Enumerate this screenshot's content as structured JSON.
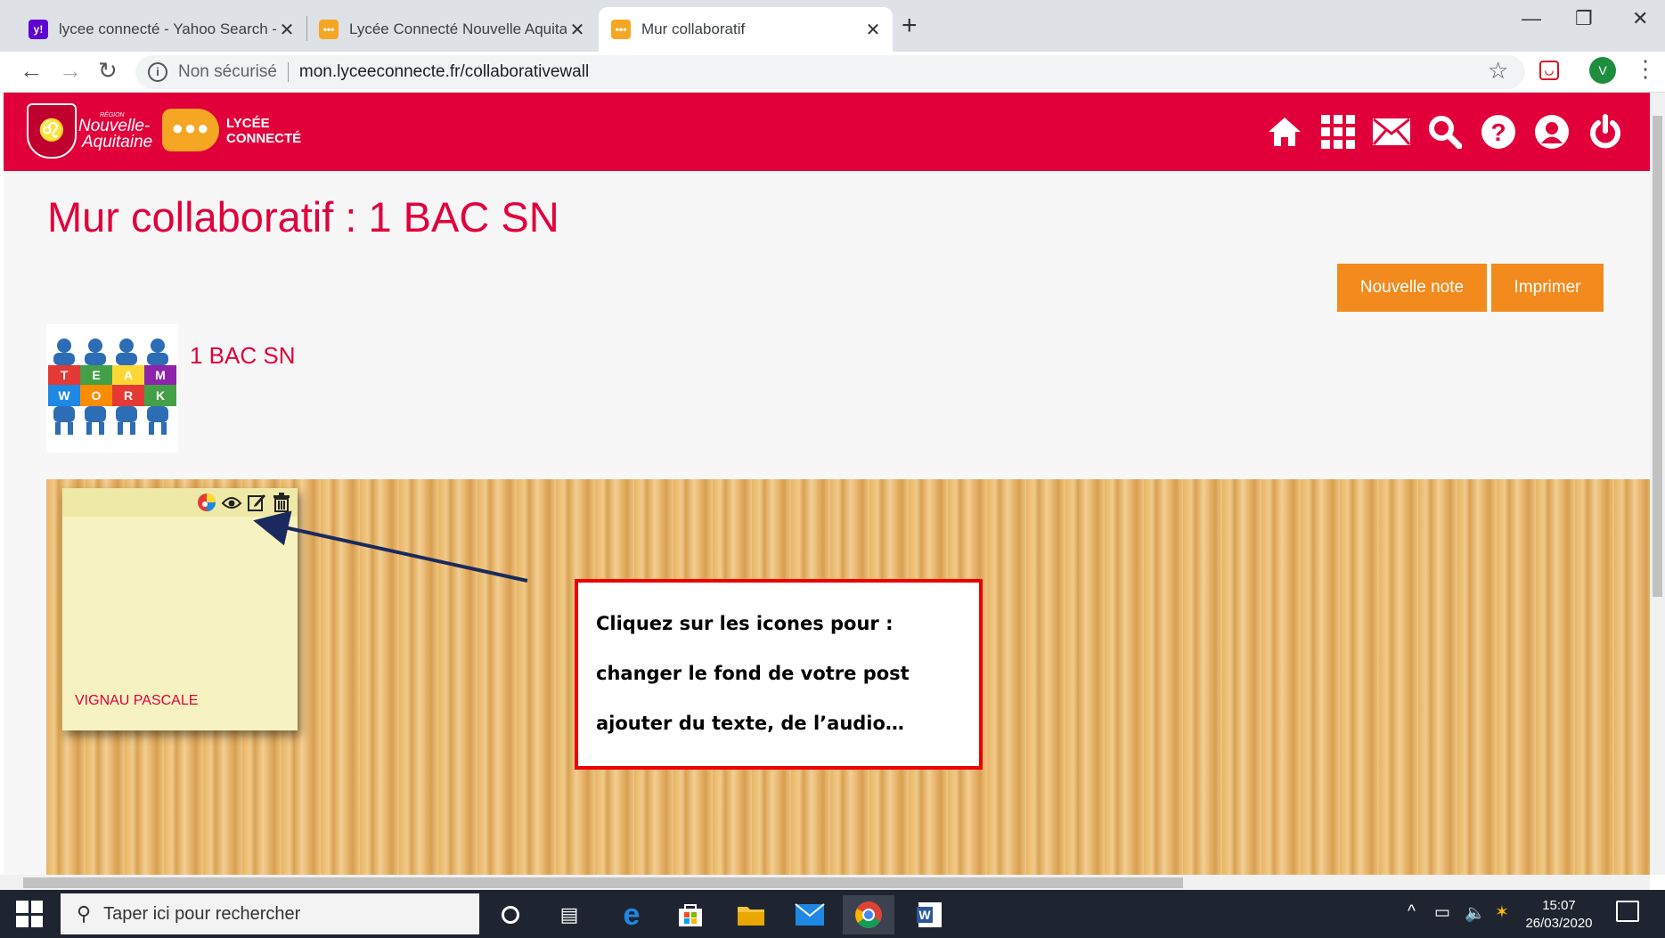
{
  "browser": {
    "tabs": [
      {
        "title": "lycee connecté - Yahoo Search - ",
        "icon": "yahoo-favicon",
        "close": "✕"
      },
      {
        "title": "Lycée Connecté Nouvelle Aquitai",
        "icon": "lycee-favicon",
        "close": "✕"
      },
      {
        "title": "Mur collaboratif",
        "icon": "lycee-favicon",
        "close": "✕"
      }
    ],
    "new_tab": "+",
    "security": "Non sécurisé",
    "url": "mon.lyceeconnecte.fr/collaborativewall",
    "profile_initial": "V"
  },
  "header": {
    "region_small": "RÉGION",
    "region_line1": "Nouvelle-",
    "region_line2": "Aquitaine",
    "app_line1": "LYCÉE",
    "app_line2": "CONNECTÉ",
    "icons": [
      "home-icon",
      "apps-grid-icon",
      "mail-icon",
      "search-icon",
      "help-icon",
      "user-icon",
      "power-icon"
    ]
  },
  "page": {
    "title": "Mur collaboratif : 1 BAC SN",
    "new_note_button": "Nouvelle note",
    "print_button": "Imprimer",
    "group_name": "1 BAC SN",
    "group_image_letters": [
      "T",
      "E",
      "A",
      "M",
      "W",
      "O",
      "R",
      "K"
    ]
  },
  "note": {
    "author": "VIGNAU PASCALE",
    "icons": [
      "color-palette-icon",
      "view-eye-icon",
      "edit-icon",
      "trash-icon"
    ]
  },
  "callout": {
    "line1": "Cliquez sur les icones pour :",
    "line2": "changer le fond de votre post",
    "line3": "ajouter du texte, de l’audio…"
  },
  "taskbar": {
    "search_placeholder": "Taper ici pour rechercher",
    "time": "15:07",
    "date": "26/03/2020"
  },
  "colors": {
    "brand_red": "#e2003b",
    "orange_button": "#f28a1e",
    "callout_border": "#e00000"
  }
}
